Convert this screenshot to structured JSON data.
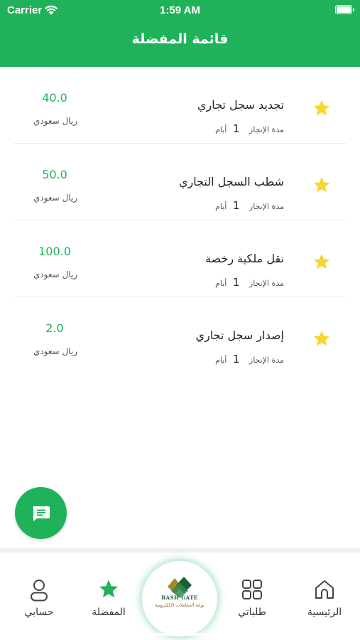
{
  "status_bar": {
    "carrier": "Carrier",
    "time": "1:59 AM"
  },
  "header": {
    "title": "قائمة المفضلة"
  },
  "favorites": [
    {
      "title": "تجديد سجل تجاري",
      "duration_label": "مدة الإنجاز",
      "duration_value": "1",
      "duration_unit": "أيام",
      "price": "40.0",
      "currency": "ريال سعودي"
    },
    {
      "title": "شطب السجل التجاري",
      "duration_label": "مدة الإنجاز",
      "duration_value": "1",
      "duration_unit": "أيام",
      "price": "50.0",
      "currency": "ريال سعودي"
    },
    {
      "title": "نقل ملكية رخصة",
      "duration_label": "مدة الإنجاز",
      "duration_value": "1",
      "duration_unit": "أيام",
      "price": "100.0",
      "currency": "ريال سعودي"
    },
    {
      "title": "إصدار سجل تجاري",
      "duration_label": "مدة الإنجاز",
      "duration_value": "1",
      "duration_unit": "أيام",
      "price": "2.0",
      "currency": "ريال سعودي"
    }
  ],
  "tabbar": {
    "account": "حسابي",
    "favorites": "المفضلة",
    "requests": "طلباتي",
    "home": "الرئيسية"
  },
  "logo": {
    "text_en": "BASH GATE",
    "text_ar": "بوابة المعاملات الإلكترونية"
  },
  "icons": {
    "fab": "message-icon",
    "star": "star-icon",
    "account": "person-icon",
    "requests": "grid-icon",
    "home": "home-icon"
  },
  "colors": {
    "primary": "#1fb25a",
    "star": "#f7d633",
    "text": "#222222",
    "muted": "#555555"
  }
}
